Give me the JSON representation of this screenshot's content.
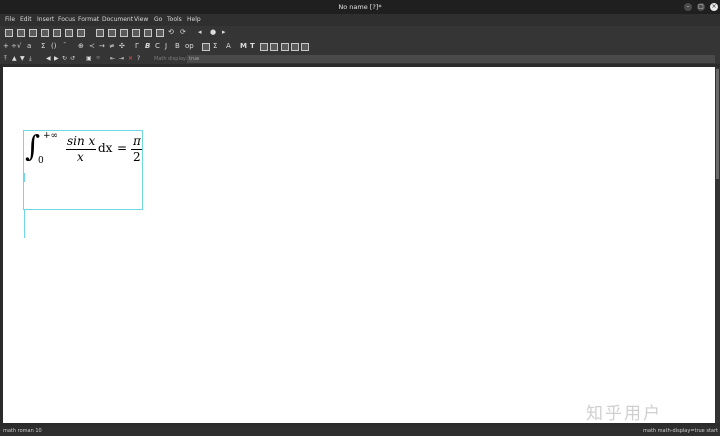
{
  "window": {
    "title": "No name [?]*"
  },
  "menu": [
    "File",
    "Edit",
    "Insert",
    "Focus",
    "Format",
    "Document",
    "View",
    "Go",
    "Tools",
    "Help"
  ],
  "toolbar": {
    "math_display_label": "Math display:",
    "math_display_value": "true"
  },
  "formula": {
    "integral": "∫",
    "lower": "0",
    "upper": "+∞",
    "numerator": "sin x",
    "denominator": "x",
    "dx": "dx",
    "equals": "=",
    "rhs_num": "π",
    "rhs_den": "2"
  },
  "watermark": "知乎用户",
  "status": {
    "left": "math roman 10",
    "right": "math math-display=true start"
  },
  "colors": {
    "selection": "#6fd8e4",
    "titlebar": "#1f1f1f"
  }
}
